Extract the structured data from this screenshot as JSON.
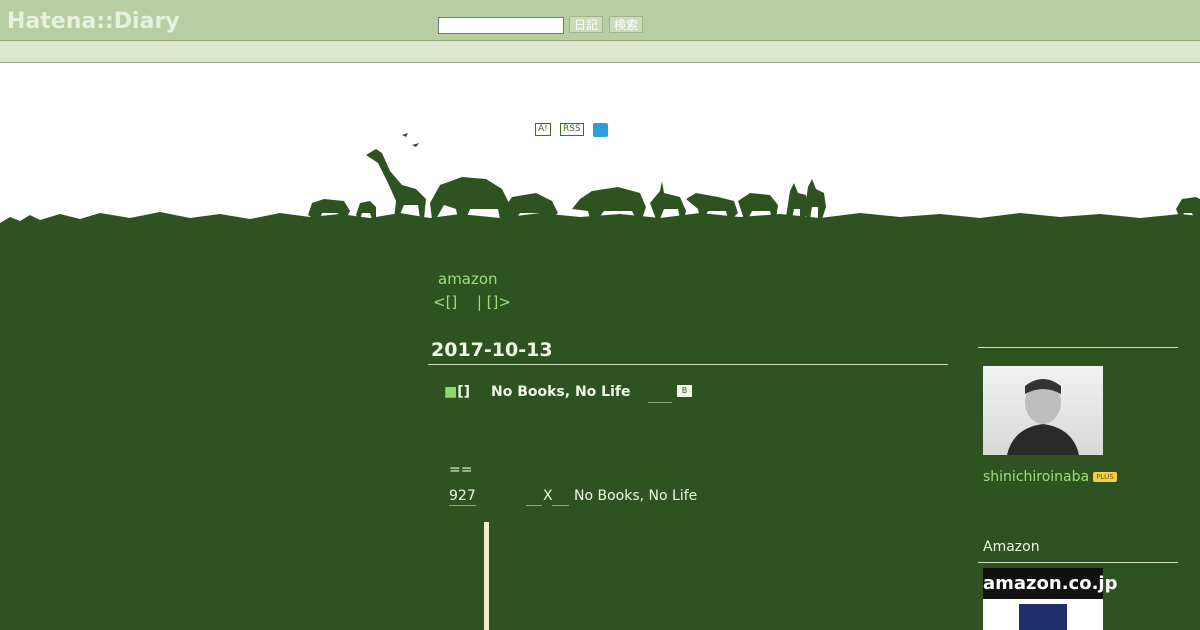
{
  "header": {
    "logo": "Hatena::Diary",
    "search_placeholder": "",
    "btn_diary": "日記",
    "btn_search": "検索"
  },
  "banner": {
    "icon_a": "A!",
    "icon_rss": "RSS",
    "icon_twitter": "twitter-icon"
  },
  "main": {
    "link": "amazon",
    "pager_prev": "<[]",
    "pager_next": "| []>",
    "date": "2017-10-13",
    "section_mark": "■[]",
    "section_title": "No Books, No Life",
    "bookmark_icon": "B",
    "eq": "==",
    "count": "927",
    "x": "X",
    "nb2": "No Books, No Life"
  },
  "sidebar": {
    "username": "shinichiroinaba",
    "plus": "PLUS",
    "amazon_heading": "Amazon",
    "amazon_logo": "amazon.co.jp"
  },
  "colors": {
    "page_bg": "#2e5321",
    "topbar_bg": "#b7cda4",
    "link": "#9be07c",
    "text": "#f1f6e6"
  }
}
